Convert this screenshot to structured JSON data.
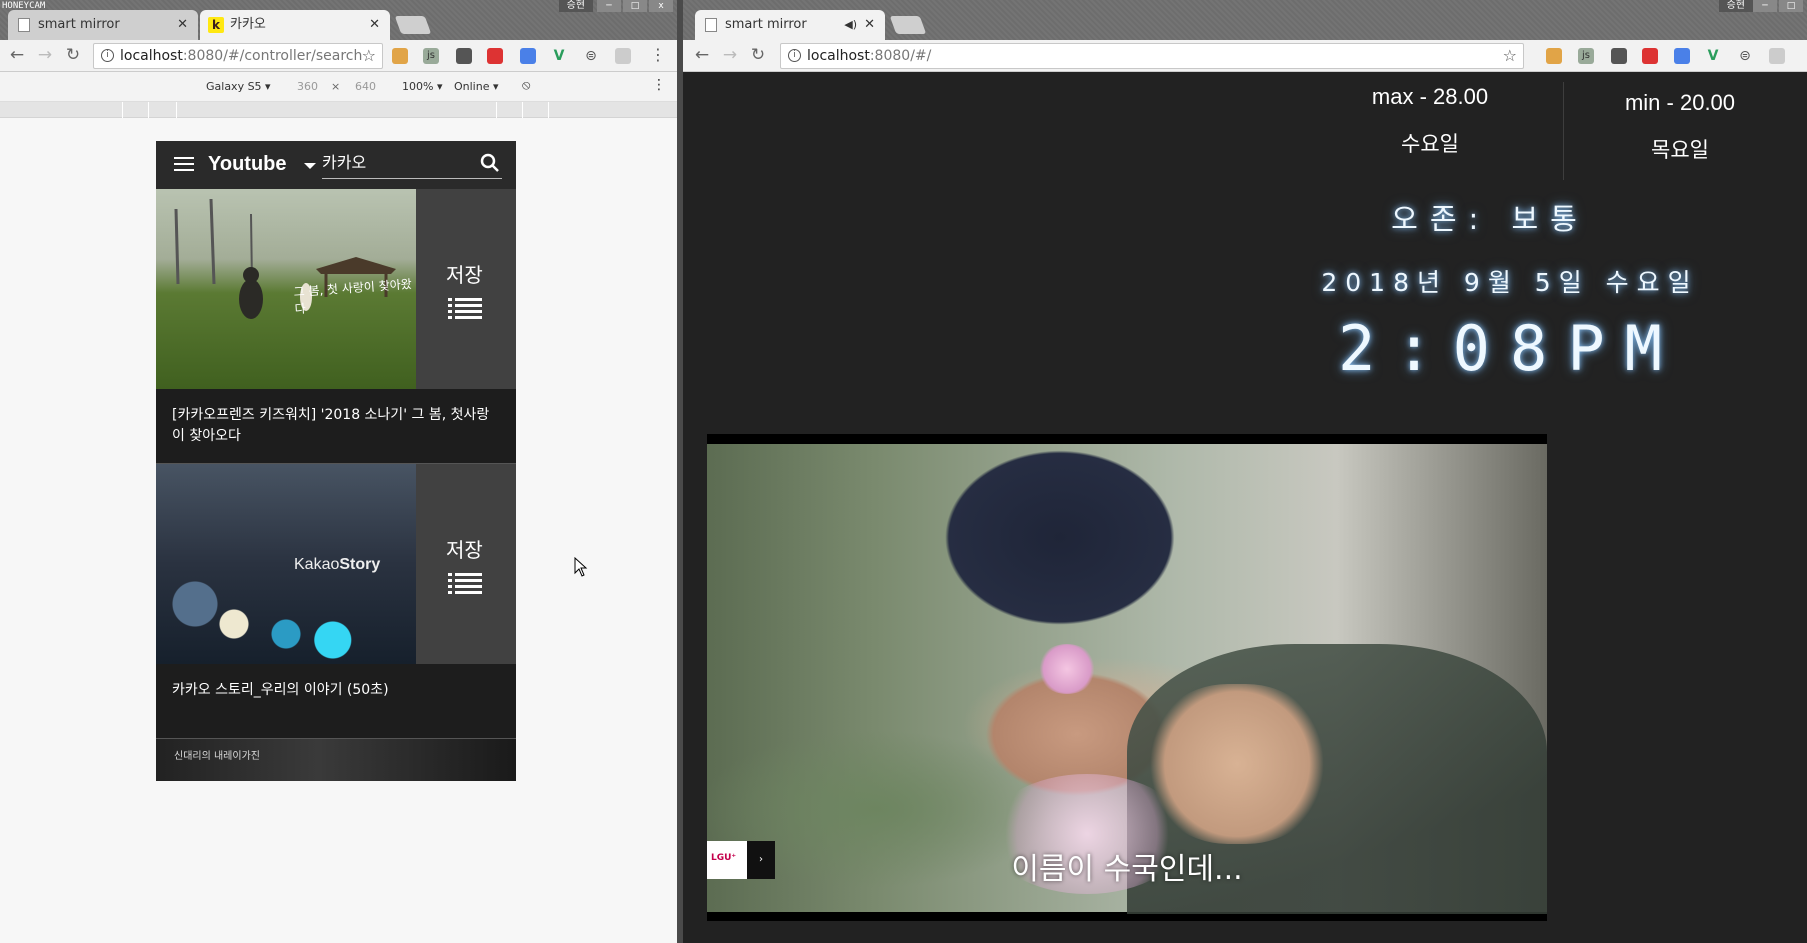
{
  "watermark": "HONEYCAM",
  "left_window": {
    "user_badge": "승현",
    "window_buttons": [
      "─",
      "□",
      "x"
    ],
    "tabs": [
      {
        "title": "smart mirror",
        "close": "✕"
      },
      {
        "title": "카카오",
        "favicon": "k",
        "close": "✕"
      }
    ],
    "url": {
      "host": "localhost",
      "path": ":8080/#/controller/search"
    },
    "device_toolbar": {
      "device": "Galaxy S5 ▾",
      "width": "360",
      "times": "×",
      "height": "640",
      "zoom": "100% ▾",
      "network": "Online ▾"
    },
    "phone": {
      "brand": "Youtube",
      "search_value": "카카오",
      "videos": [
        {
          "thumb_text": "그 봄, 첫 사랑이 찾아왔다",
          "save_label": "저장",
          "caption": "[카카오프렌즈 키즈워치] '2018 소나기' 그 봄, 첫사랑이 찾아오다"
        },
        {
          "thumb_text_light": "Kakao",
          "thumb_text_bold": "Story",
          "save_label": "저장",
          "caption": "카카오 스토리_우리의 이야기 (50초)"
        }
      ],
      "partial_thumb_text": "신대리의 내레이가진"
    }
  },
  "right_window": {
    "user_badge": "승현",
    "window_buttons": [
      "─",
      "□"
    ],
    "tab": {
      "title": "smart mirror",
      "mute": "◀ׅ",
      "close": "✕"
    },
    "url": {
      "host": "localhost",
      "path": ":8080/#/"
    }
  },
  "mirror": {
    "weather": [
      {
        "temp": "max - 28.00",
        "day": "수요일"
      },
      {
        "temp": "min - 20.00",
        "day": "목요일"
      }
    ],
    "ozone": "오존: 보통",
    "date": "2018년 9월 5일 수요일",
    "time": "2:08PM",
    "video": {
      "subtitle": "이름이 수국인데...",
      "brand_badge": "LGU⁺"
    }
  },
  "colors": {
    "mirror_bg": "#222222",
    "glow": "#8cc8ff",
    "kakao_yellow": "#ffe812"
  }
}
